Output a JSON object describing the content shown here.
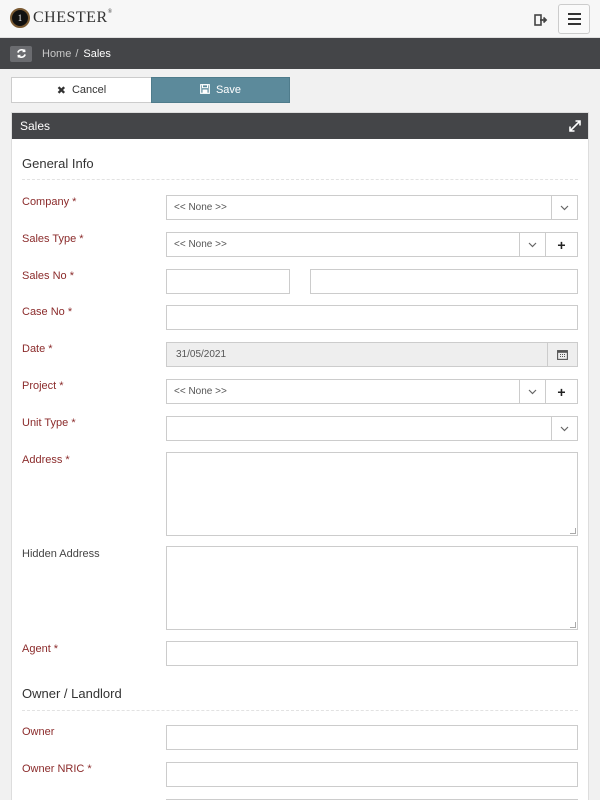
{
  "app": {
    "logo_mark": "1",
    "logo_text": "CHESTER",
    "logo_sup": "®"
  },
  "header": {
    "logout_icon": "sign-out-icon",
    "menu_icon": "hamburger-icon"
  },
  "breadcrumb": {
    "refresh_icon": "refresh-icon",
    "home": "Home",
    "separator": "/",
    "current": "Sales"
  },
  "actions": {
    "cancel_label": "Cancel",
    "save_label": "Save"
  },
  "panel": {
    "title": "Sales"
  },
  "sections": {
    "general": "General Info",
    "owner": "Owner / Landlord"
  },
  "fields": {
    "company": {
      "label": "Company *",
      "value": "<< None >>"
    },
    "sales_type": {
      "label": "Sales Type *",
      "value": "<< None >>"
    },
    "sales_no": {
      "label": "Sales No *",
      "value_a": "",
      "value_b": ""
    },
    "case_no": {
      "label": "Case No *",
      "value": ""
    },
    "date": {
      "label": "Date *",
      "value": "31/05/2021"
    },
    "project": {
      "label": "Project *",
      "value": "<< None >>"
    },
    "unit_type": {
      "label": "Unit Type *",
      "value": ""
    },
    "address": {
      "label": "Address *",
      "value": ""
    },
    "hidden_address": {
      "label": "Hidden Address",
      "value": ""
    },
    "agent": {
      "label": "Agent *",
      "value": ""
    },
    "owner": {
      "label": "Owner",
      "value": ""
    },
    "owner_nric": {
      "label": "Owner NRIC *",
      "value": ""
    }
  },
  "colors": {
    "header_dark": "#444548",
    "save_button": "#5c8a9b",
    "required_label": "#8b2b2b"
  }
}
